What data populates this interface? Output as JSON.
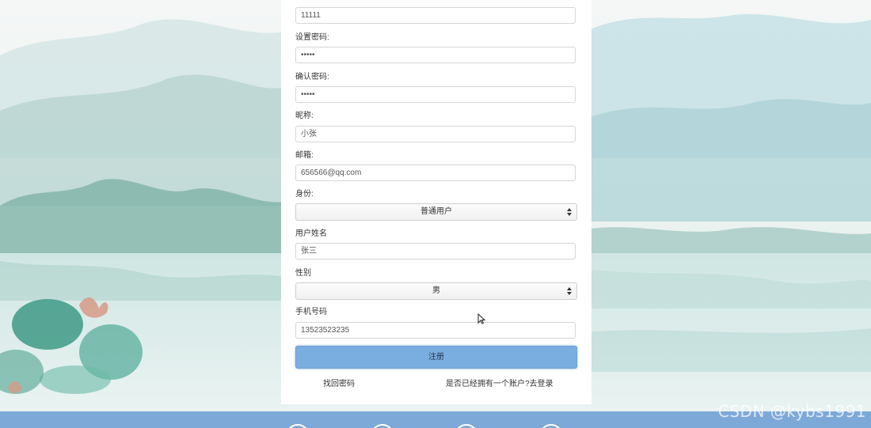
{
  "form": {
    "account_value": "11111",
    "password_label": "设置密码:",
    "password_value": "•••••",
    "confirm_label": "确认密码:",
    "confirm_value": "•••••",
    "nickname_label": "昵称:",
    "nickname_value": "小张",
    "email_label": "邮箱:",
    "email_value": "656566@qq.com",
    "role_label": "身份:",
    "role_value": "普通用户",
    "realname_label": "用户姓名",
    "realname_value": "张三",
    "gender_label": "性别",
    "gender_value": "男",
    "phone_label": "手机号码",
    "phone_value": "13523523235",
    "submit_label": "注册",
    "forgot_link": "找回密码",
    "login_link": "是否已经拥有一个账户?去登录"
  },
  "watermark": "CSDN @kybs1991",
  "colors": {
    "button": "#7aaee0",
    "footer": "#7da9d9",
    "card": "#ffffff"
  }
}
